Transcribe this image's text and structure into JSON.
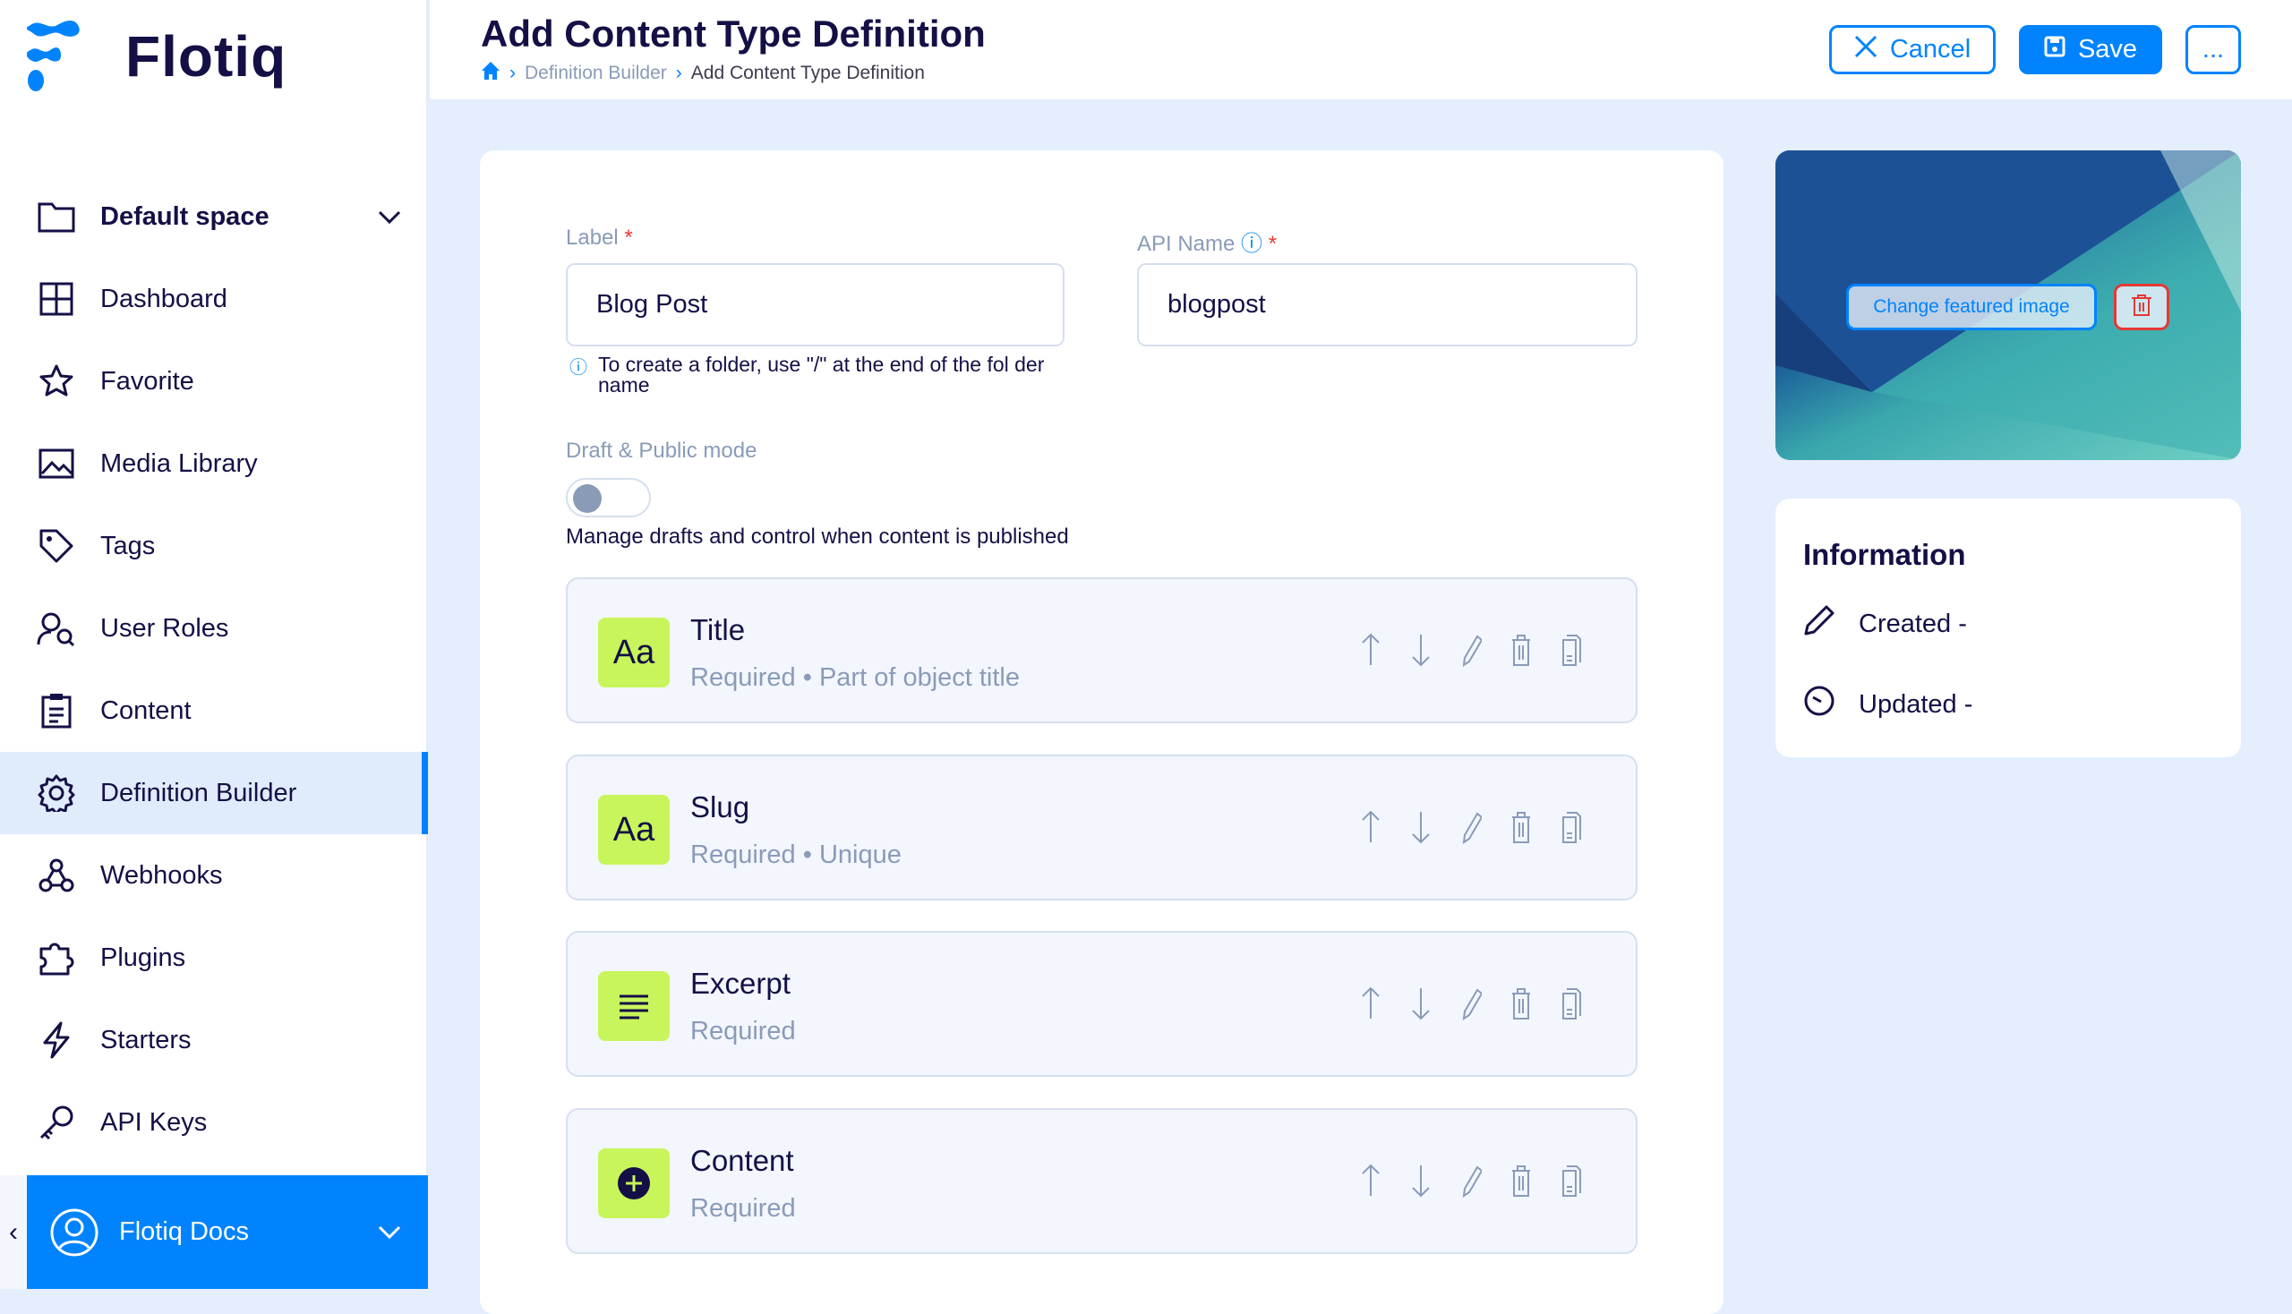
{
  "brand": {
    "name": "Flotiq"
  },
  "sidebar": {
    "space": "Default space",
    "items": [
      {
        "label": "Dashboard",
        "icon": "dashboard-icon"
      },
      {
        "label": "Favorite",
        "icon": "star-icon"
      },
      {
        "label": "Media Library",
        "icon": "image-icon"
      },
      {
        "label": "Tags",
        "icon": "tag-icon"
      },
      {
        "label": "User Roles",
        "icon": "user-roles-icon"
      },
      {
        "label": "Content",
        "icon": "clipboard-icon"
      },
      {
        "label": "Definition Builder",
        "icon": "gear-icon",
        "active": true
      },
      {
        "label": "Webhooks",
        "icon": "webhook-icon"
      },
      {
        "label": "Plugins",
        "icon": "puzzle-icon"
      },
      {
        "label": "Starters",
        "icon": "lightning-icon"
      },
      {
        "label": "API Keys",
        "icon": "key-icon"
      }
    ],
    "user": "Flotiq Docs"
  },
  "header": {
    "title": "Add Content Type Definition",
    "breadcrumb": [
      "Definition Builder",
      "Add Content Type Definition"
    ],
    "cancel": "Cancel",
    "save": "Save",
    "more": "..."
  },
  "form": {
    "label_label": "Label",
    "label_value": "Blog Post",
    "api_label": "API Name",
    "api_value": "blogpost",
    "required_mark": "*",
    "help": "To create a folder, use \"/\" at the end of the fol der name",
    "draft_label": "Draft & Public mode",
    "draft_enabled": false,
    "draft_desc": "Manage drafts and control when content is published"
  },
  "fields": [
    {
      "name": "Title",
      "sub": "Required • Part of object title",
      "icon": "Aa"
    },
    {
      "name": "Slug",
      "sub": "Required • Unique",
      "icon": "Aa"
    },
    {
      "name": "Excerpt",
      "sub": "Required",
      "icon": "≡"
    },
    {
      "name": "Content",
      "sub": "Required",
      "icon": "+"
    }
  ],
  "featured": {
    "change": "Change featured image"
  },
  "info": {
    "title": "Information",
    "created": "Created -",
    "updated": "Updated -"
  },
  "colors": {
    "accent": "#0083fc",
    "field_icon": "#c8f55b",
    "danger": "#e53935",
    "text": "#141046"
  }
}
